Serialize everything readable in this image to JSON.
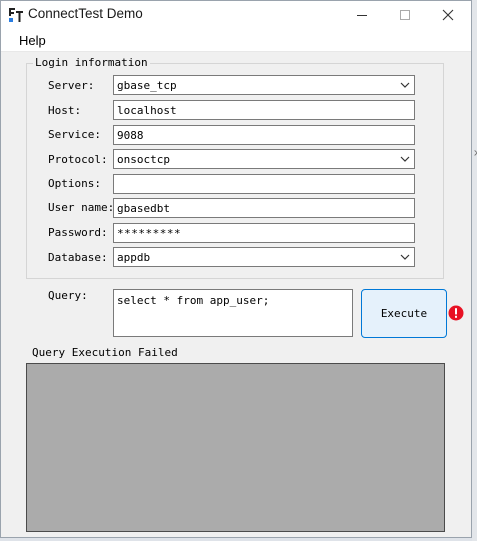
{
  "window": {
    "title": "ConnectTest Demo",
    "icon": "connect-app-icon"
  },
  "menu": [
    {
      "label": "Help"
    }
  ],
  "login": {
    "legend": "Login information",
    "server": {
      "label": "Server:",
      "value": "gbase_tcp"
    },
    "host": {
      "label": "Host:",
      "value": "localhost"
    },
    "service": {
      "label": "Service:",
      "value": "9088"
    },
    "protocol": {
      "label": "Protocol:",
      "value": "onsoctcp"
    },
    "options": {
      "label": "Options:",
      "value": ""
    },
    "user": {
      "label": "User name:",
      "value": "gbasedbt"
    },
    "password": {
      "label": "Password:",
      "value": "*********"
    },
    "database": {
      "label": "Database:",
      "value": "appdb"
    }
  },
  "query": {
    "label": "Query:",
    "value": "select * from app_user;",
    "execute_label": "Execute",
    "error_icon": "error-icon"
  },
  "result": {
    "status": "Query Execution Failed",
    "background": "#ababab"
  },
  "colors": {
    "accent": "#0078d7",
    "error": "#e81123"
  }
}
